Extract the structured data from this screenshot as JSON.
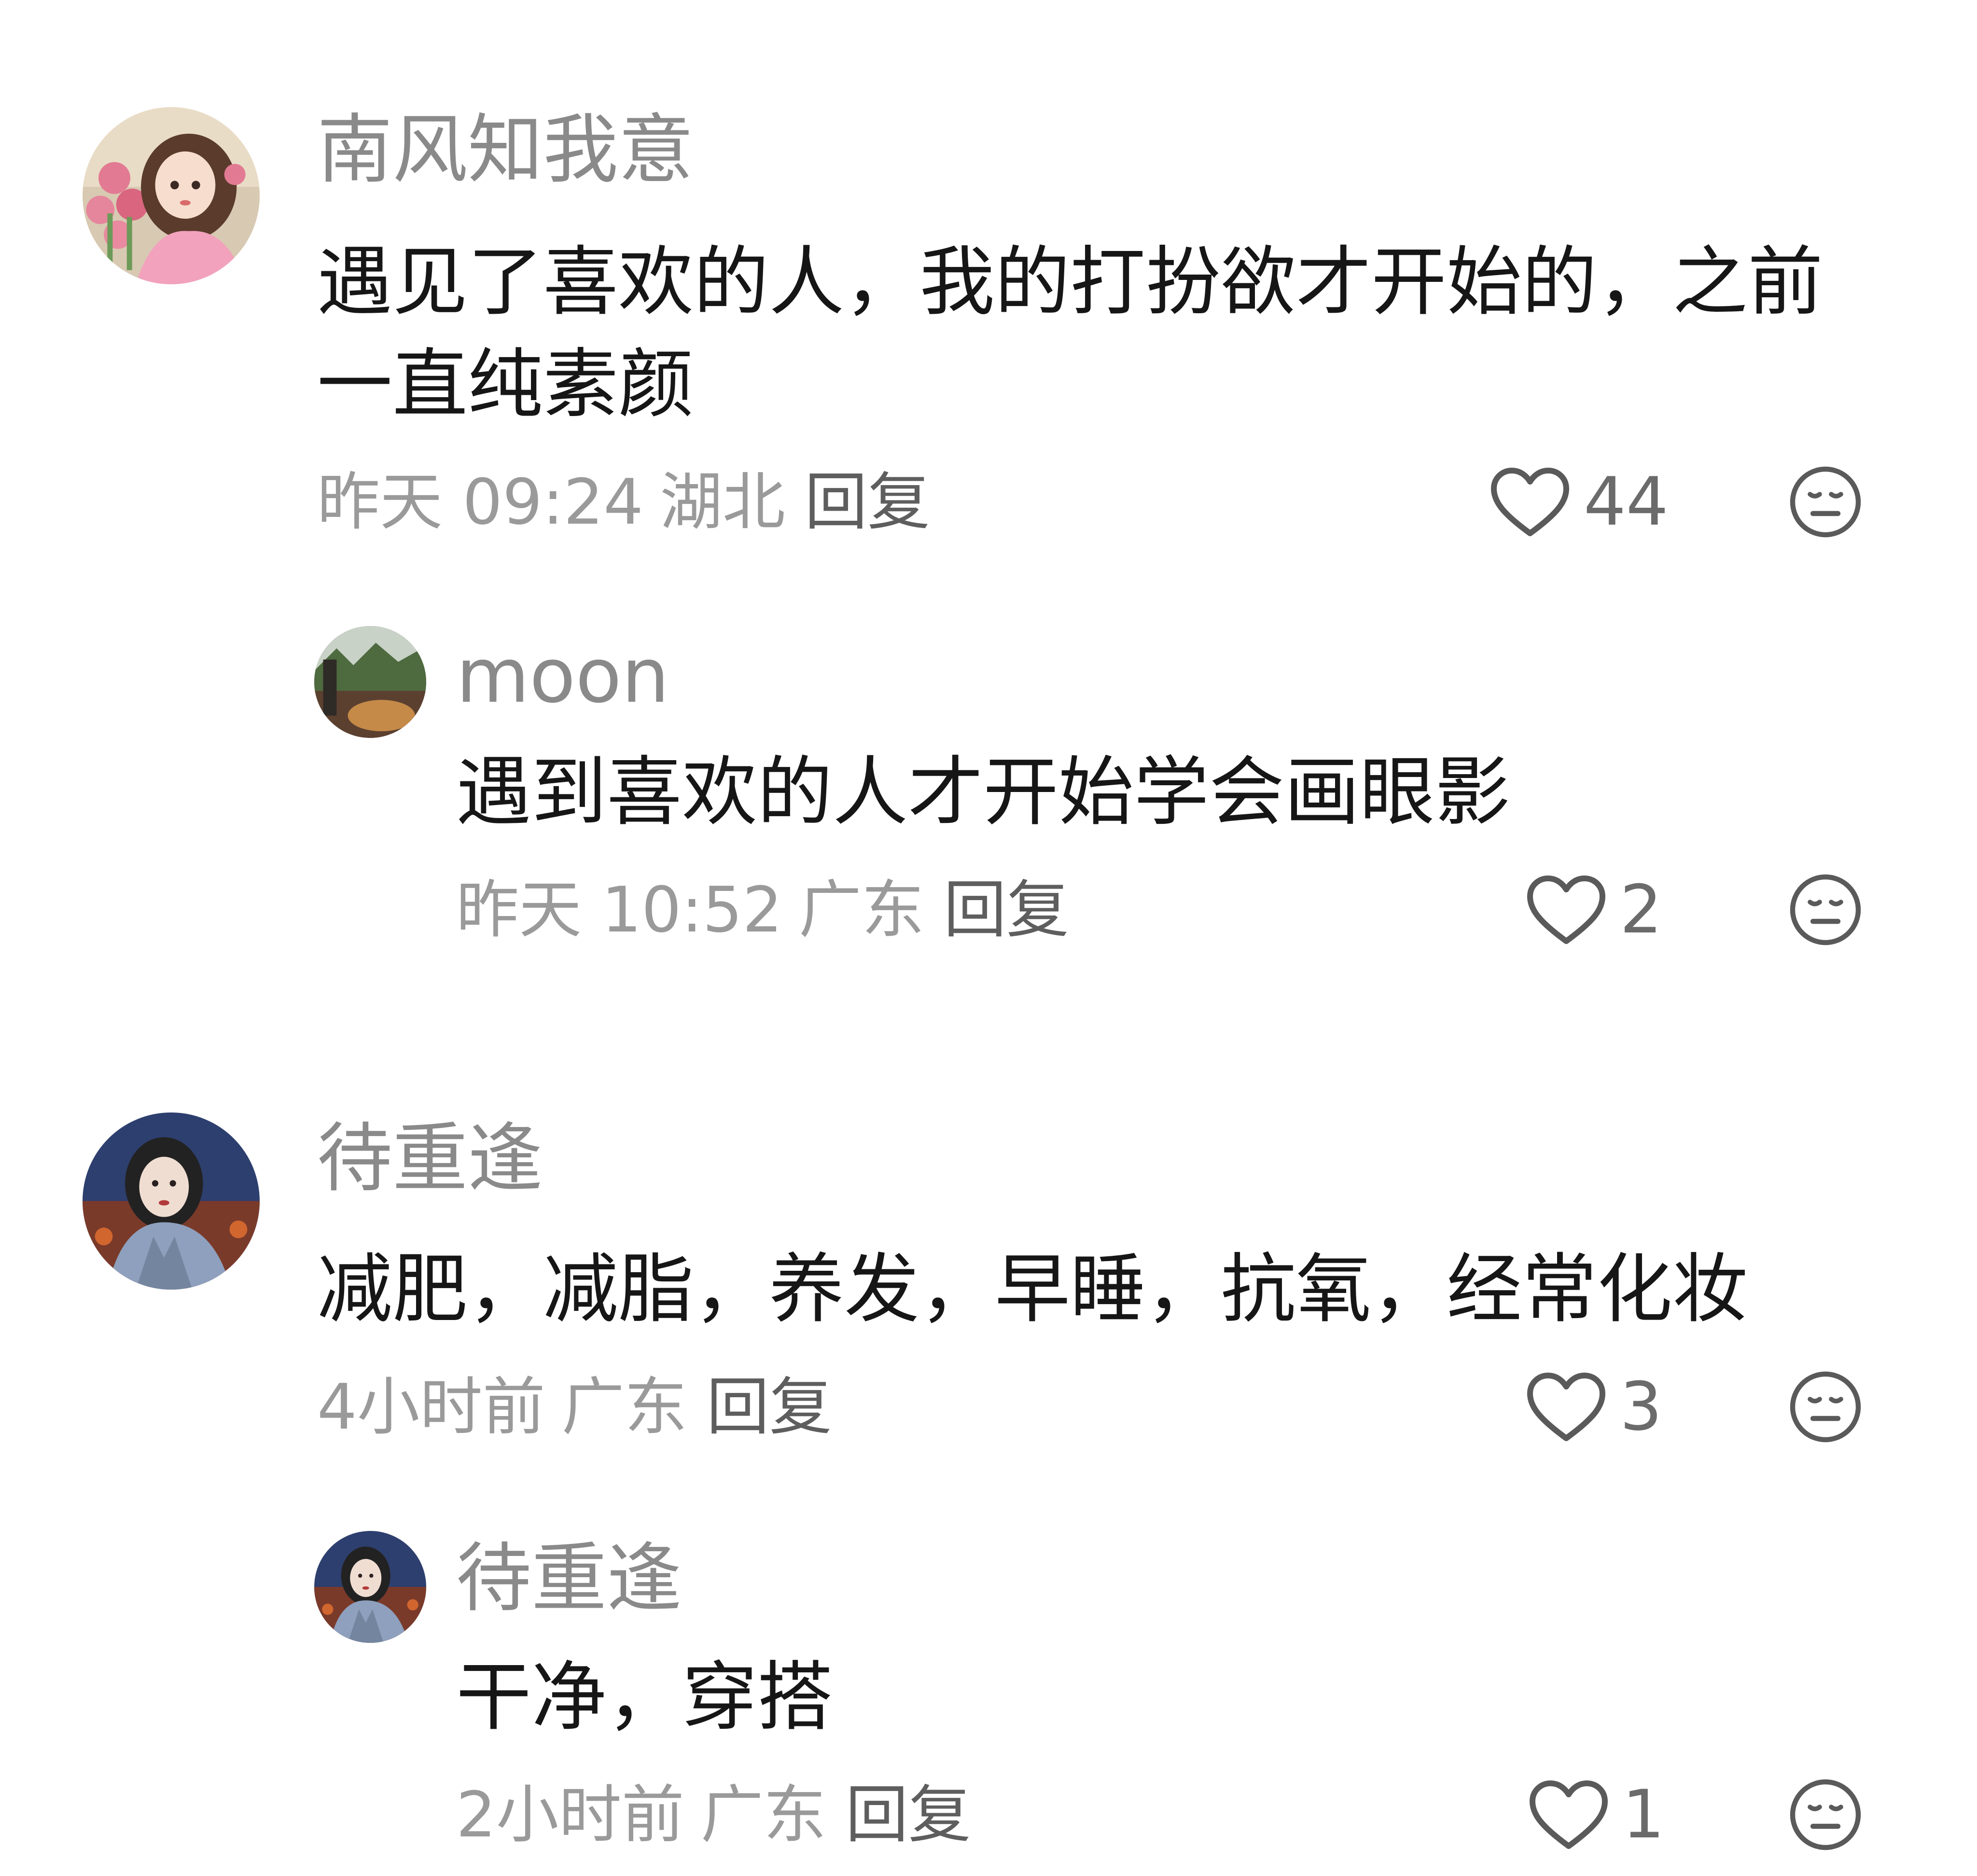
{
  "comments": [
    {
      "username": "南风知我意",
      "content_lines": [
        "遇见了喜欢的人，我的打扮欲才开始的，之前",
        "一直纯素颜"
      ],
      "time": "昨天 09:24",
      "location": "湖北",
      "reply_label": "回复",
      "likes": "44",
      "reply": {
        "username": "moon",
        "content": "遇到喜欢的人才开始学会画眼影",
        "time": "昨天 10:52",
        "location": "广东",
        "reply_label": "回复",
        "likes": "2"
      }
    },
    {
      "username": "待重逢",
      "content_lines": [
        "减肥，减脂，养发，早睡，抗氧，经常化妆"
      ],
      "time": "4小时前",
      "location": "广东",
      "reply_label": "回复",
      "likes": "3",
      "reply": {
        "username": "待重逢",
        "content": "干净，穿搭",
        "time": "2小时前",
        "location": "广东",
        "reply_label": "回复",
        "likes": "1"
      }
    }
  ],
  "icons": {
    "like": "heart-outline-icon",
    "dislike": "neutral-face-icon"
  },
  "colors": {
    "username": "#8a8a8a",
    "content": "#161616",
    "meta": "#9a9a9a",
    "reply": "#5e5e5e",
    "icon": "#5a5a5a"
  }
}
